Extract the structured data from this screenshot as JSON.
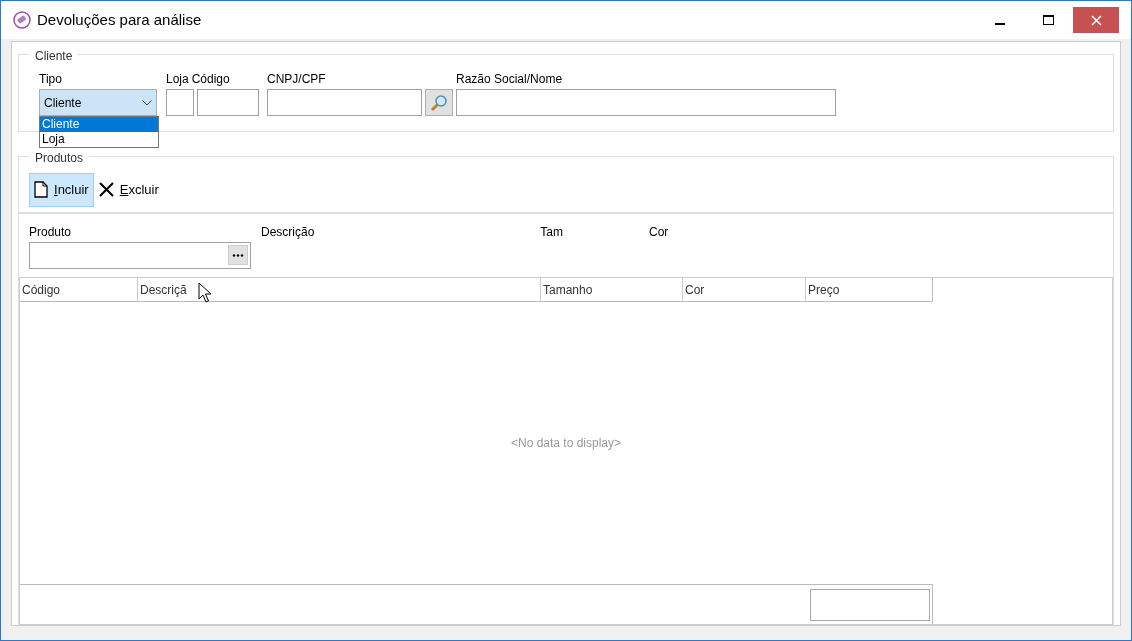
{
  "window": {
    "title": "Devoluções para análise"
  },
  "cliente": {
    "legend": "Cliente",
    "tipo": {
      "label": "Tipo",
      "value": "Cliente",
      "expanded": true,
      "options": [
        {
          "label": "Cliente",
          "selected": true
        },
        {
          "label": "Loja",
          "selected": false
        }
      ]
    },
    "loja": {
      "label": "Loja"
    },
    "codigo": {
      "label": "Código"
    },
    "cnpj": {
      "label": "CNPJ/CPF"
    },
    "razao": {
      "label": "Razão Social/Nome"
    }
  },
  "produtos": {
    "legend": "Produtos",
    "toolbar": [
      {
        "label": "Incluir",
        "kind": "new",
        "hovered": true
      },
      {
        "label": "Excluir",
        "kind": "delete",
        "hovered": false
      }
    ],
    "produto_label": "Produto",
    "descricao_label": "Descrição",
    "tam_label": "Tam",
    "cor_label": "Cor",
    "table": {
      "columns": [
        "Código",
        "Descriçã",
        "Tamanho",
        "Cor",
        "Preço"
      ],
      "empty_text": "<No data to display>"
    }
  }
}
